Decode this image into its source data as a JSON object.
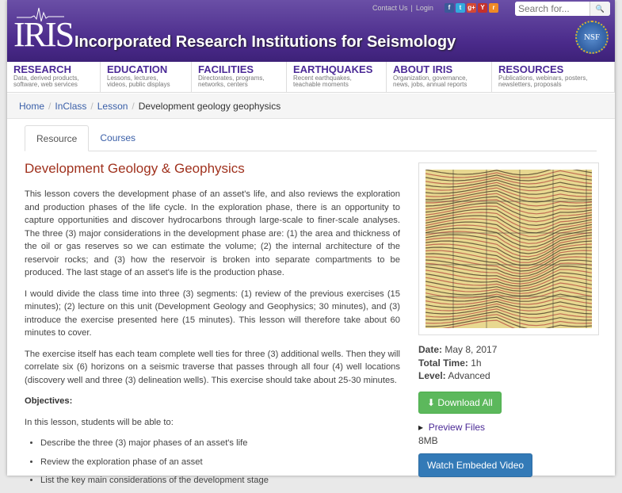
{
  "header": {
    "logo": "IRIS",
    "title": "Incorporated Research Institutions for Seismology",
    "contact": "Contact Us",
    "login": "Login",
    "search_placeholder": "Search for...",
    "nsf": "NSF",
    "social": [
      {
        "name": "facebook",
        "glyph": "f",
        "color": "#3b5998"
      },
      {
        "name": "twitter",
        "glyph": "t",
        "color": "#33aadd"
      },
      {
        "name": "google-plus",
        "glyph": "g+",
        "color": "#d34836"
      },
      {
        "name": "youtube",
        "glyph": "Y",
        "color": "#c4302b"
      },
      {
        "name": "rss",
        "glyph": "r",
        "color": "#f08a24"
      }
    ]
  },
  "nav": [
    {
      "title": "RESEARCH",
      "sub1": "Data, derived products,",
      "sub2": "software, web services"
    },
    {
      "title": "EDUCATION",
      "sub1": "Lessons, lectures,",
      "sub2": "videos, public displays"
    },
    {
      "title": "FACILITIES",
      "sub1": "Directorates, programs,",
      "sub2": "networks, centers"
    },
    {
      "title": "EARTHQUAKES",
      "sub1": "Recent earthquakes,",
      "sub2": "teachable moments"
    },
    {
      "title": "ABOUT IRIS",
      "sub1": "Organization, governance,",
      "sub2": "news, jobs, annual reports"
    },
    {
      "title": "RESOURCES",
      "sub1": "Publications, webinars, posters,",
      "sub2": "newsletters, proposals"
    }
  ],
  "breadcrumb": {
    "home": "Home",
    "inclass": "InClass",
    "lesson": "Lesson",
    "current": "Development geology geophysics"
  },
  "tabs": {
    "resource": "Resource",
    "courses": "Courses"
  },
  "main": {
    "title": "Development Geology & Geophysics",
    "p1": "This lesson covers the development phase of an asset's life, and also reviews the exploration and production phases of the life cycle. In the exploration phase, there is an opportunity to capture opportunities and discover hydrocarbons through large-scale to finer-scale analyses. The three (3) major considerations in the development phase are: (1) the area and thickness of the oil or gas reserves so we can estimate the volume; (2) the internal architecture of the reservoir rocks; and (3) how the reservoir is broken into separate compartments to be produced. The last stage of an asset's life is the production phase.",
    "p2": "I would divide the class time into three (3) segments: (1) review of the previous exercises (15 minutes); (2) lecture on this unit (Development Geology and Geophysics; 30 minutes), and (3) introduce the exercise presented here (15 minutes). This lesson will therefore take about 60 minutes to cover.",
    "p3": "The exercise itself has each team complete well ties for three (3) additional wells. Then they will correlate six (6) horizons on a seismic traverse that passes through all four (4) well locations (discovery well and three (3) delineation wells). This exercise should take about 25-30 minutes.",
    "objectives": "Objectives:",
    "intro": "In this lesson, students will be able to:",
    "bullets": [
      "Describe the three (3) major phases of an asset's life",
      "Review the exploration phase of an asset",
      "List the key main considerations of the development stage"
    ]
  },
  "side": {
    "date_label": "Date:",
    "date": "May 8, 2017",
    "time_label": "Total Time:",
    "time": "1h",
    "level_label": "Level:",
    "level": "Advanced",
    "download": "Download All",
    "preview": "Preview Files",
    "size": "8MB",
    "video": "Watch Embeded Video"
  }
}
